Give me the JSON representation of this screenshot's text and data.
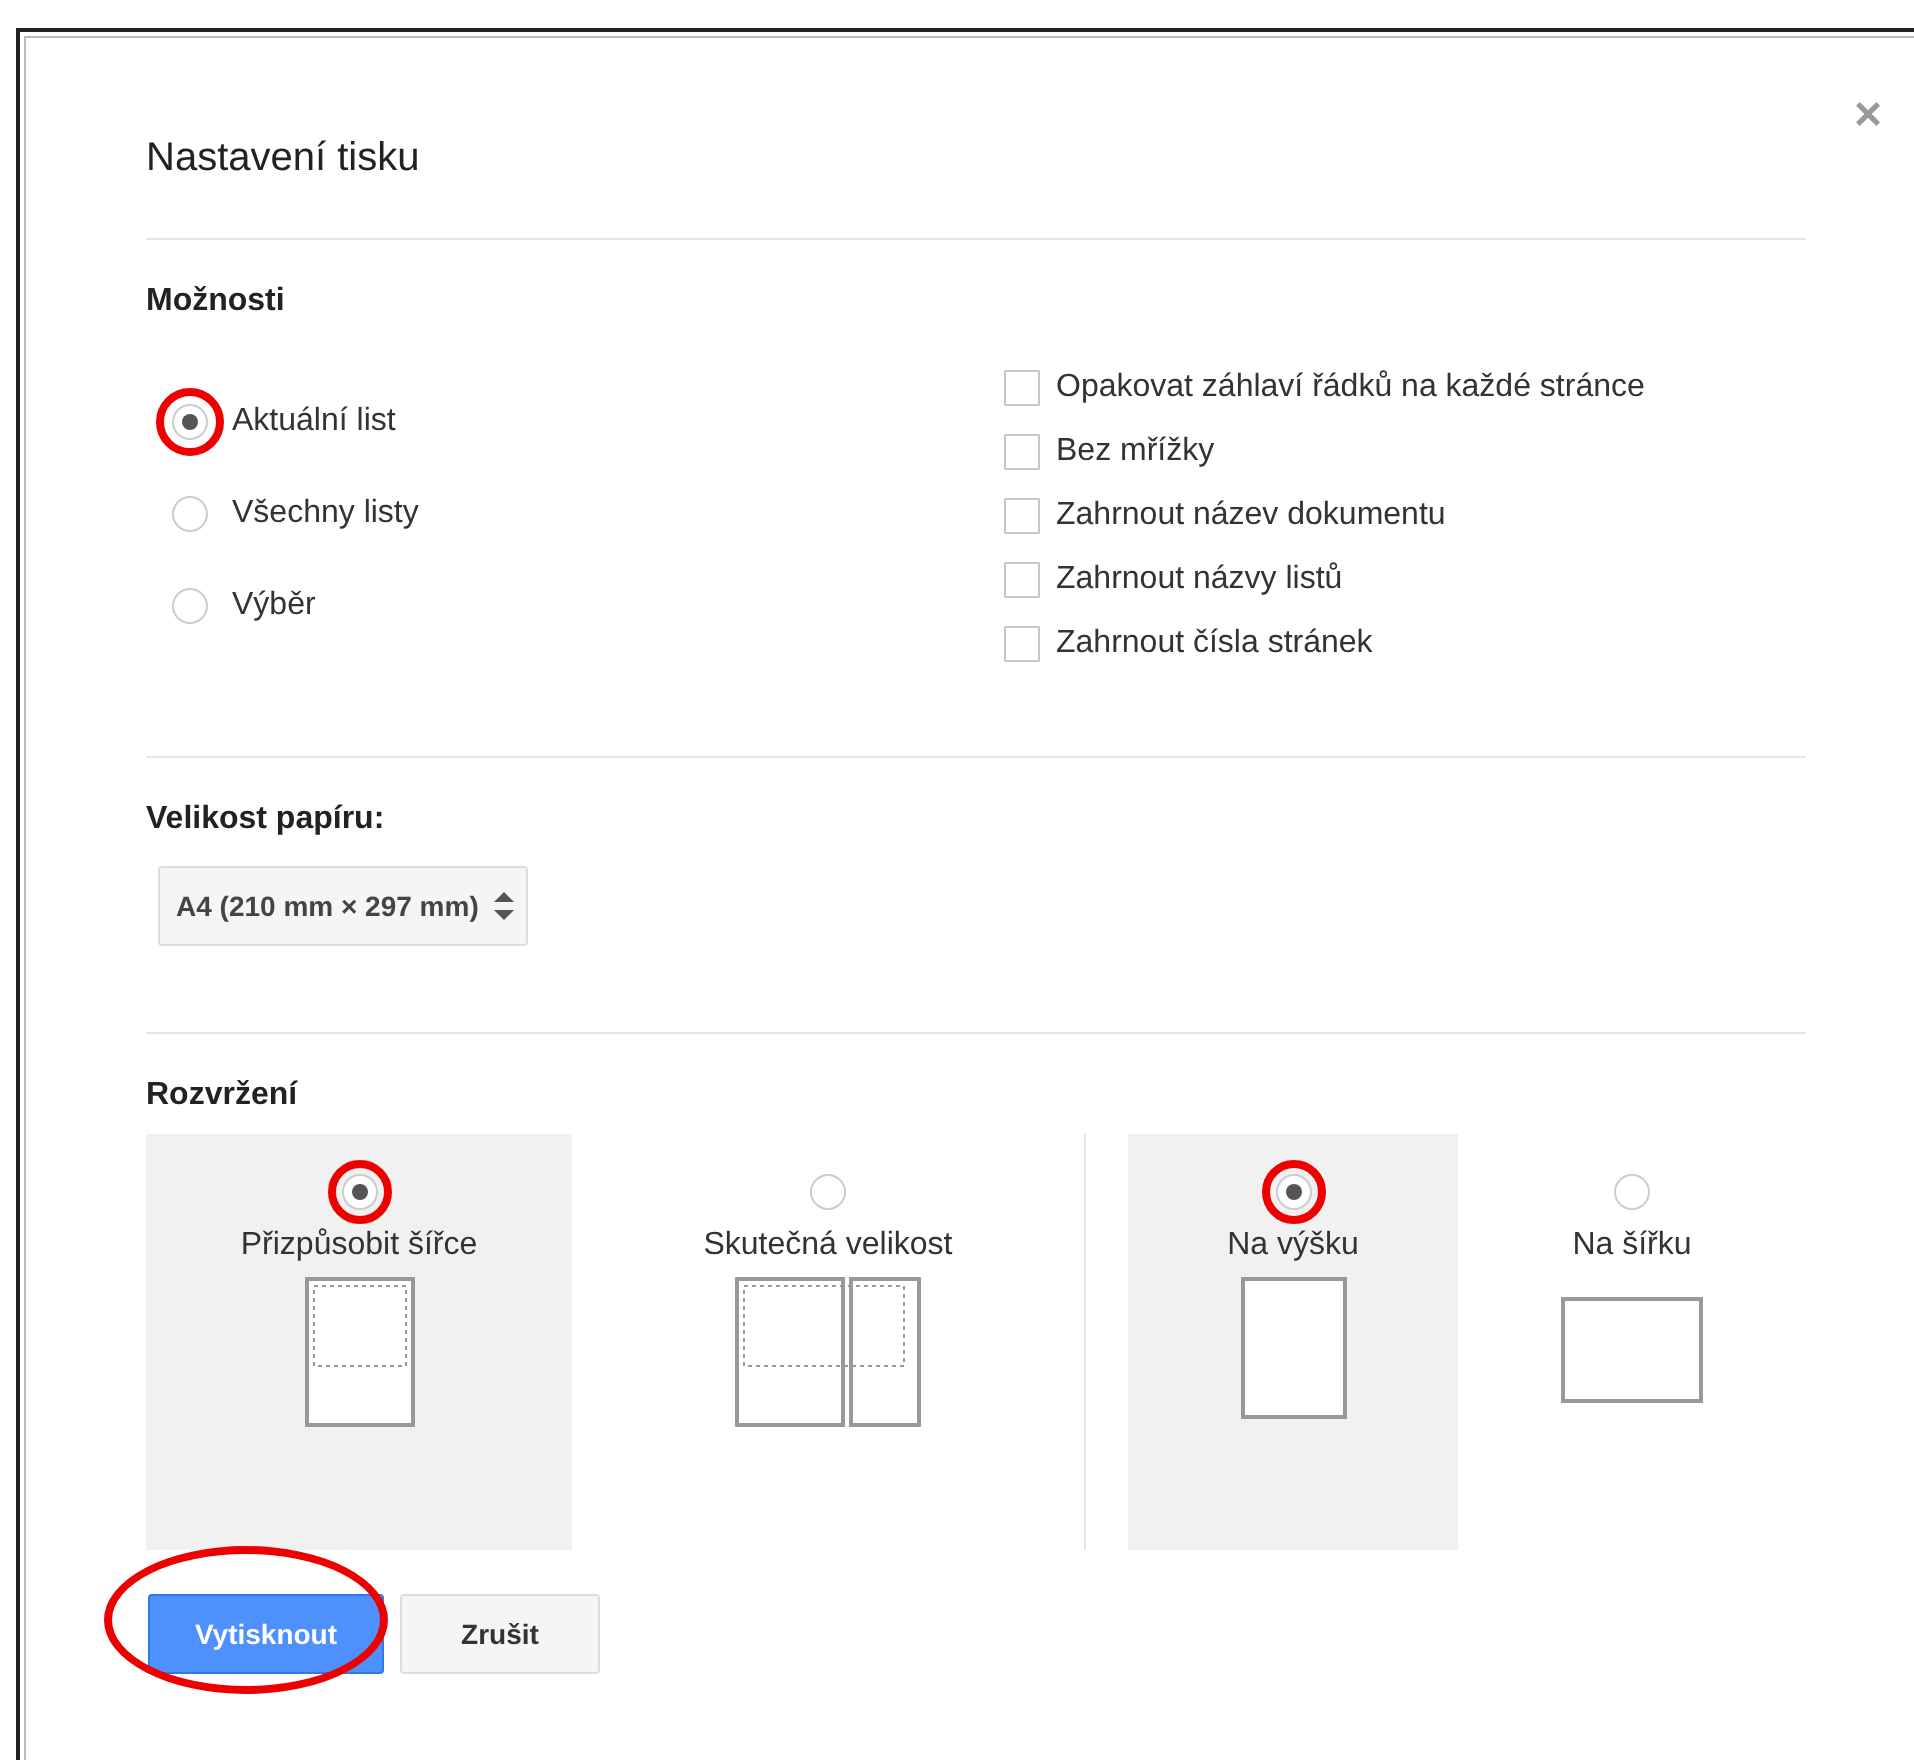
{
  "dialog": {
    "title": "Nastavení tisku",
    "close": "×"
  },
  "options": {
    "heading": "Možnosti",
    "scope": [
      {
        "label": "Aktuální list",
        "selected": true,
        "circled": true
      },
      {
        "label": "Všechny listy",
        "selected": false,
        "circled": false
      },
      {
        "label": "Výběr",
        "selected": false,
        "circled": false
      }
    ],
    "checkboxes": [
      {
        "label": "Opakovat záhlaví řádků na každé stránce",
        "checked": false
      },
      {
        "label": "Bez mřížky",
        "checked": false
      },
      {
        "label": "Zahrnout název dokumentu",
        "checked": false
      },
      {
        "label": "Zahrnout názvy listů",
        "checked": false
      },
      {
        "label": "Zahrnout čísla stránek",
        "checked": false
      }
    ]
  },
  "paper_size": {
    "heading": "Velikost papíru:",
    "value": "A4 (210 mm × 297 mm)"
  },
  "layout": {
    "heading": "Rozvržení",
    "scale": [
      {
        "kind": "fit",
        "label": "Přizpůsobit šířce",
        "selected": true,
        "circled": true
      },
      {
        "kind": "actual",
        "label": "Skutečná velikost",
        "selected": false,
        "circled": false
      }
    ],
    "orientation": [
      {
        "kind": "portrait",
        "label": "Na výšku",
        "selected": true,
        "circled": true
      },
      {
        "kind": "landscape",
        "label": "Na šířku",
        "selected": false,
        "circled": false
      }
    ]
  },
  "buttons": [
    {
      "kind": "primary",
      "label": "Vytisknout",
      "circled": true
    },
    {
      "kind": "secondary",
      "label": "Zrušit",
      "circled": false
    }
  ]
}
